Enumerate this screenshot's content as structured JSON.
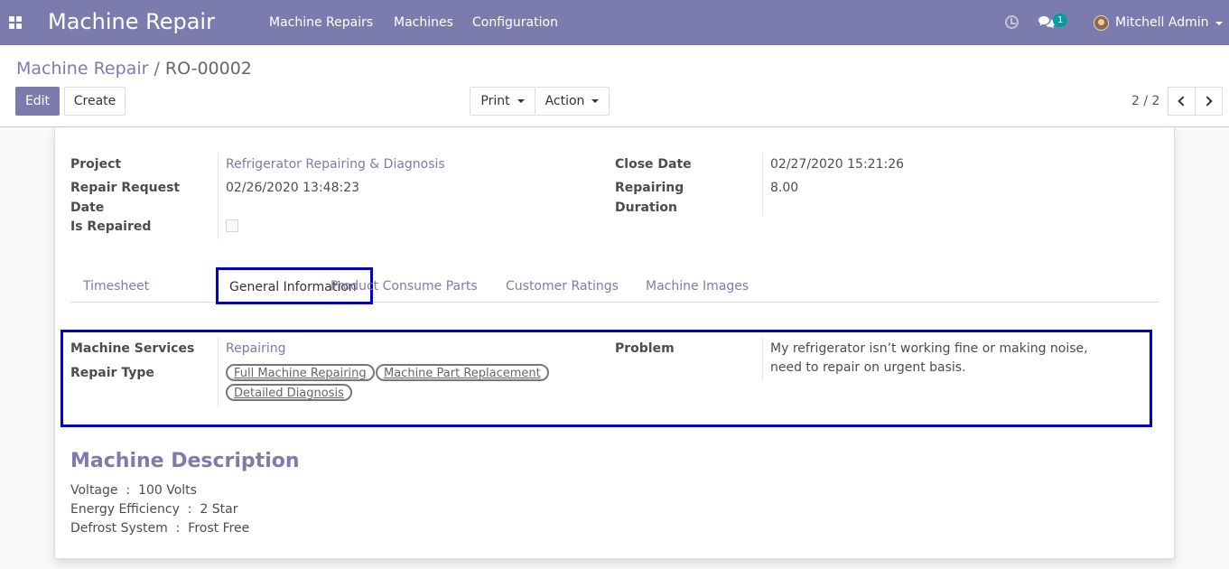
{
  "navbar": {
    "app_title": "Machine Repair",
    "menu": [
      "Machine Repairs",
      "Machines",
      "Configuration"
    ],
    "chat_count": "1",
    "user_name": "Mitchell Admin",
    "color": "#7c7bad"
  },
  "control_panel": {
    "breadcrumb_parent": "Machine Repair",
    "breadcrumb_separator": "/",
    "breadcrumb_current": "RO-00002",
    "edit_label": "Edit",
    "create_label": "Create",
    "print_label": "Print",
    "action_label": "Action",
    "pager_value": "2 / 2"
  },
  "form": {
    "project_label": "Project",
    "project_value": "Refrigerator Repairing & Diagnosis",
    "repair_request_date_label_1": "Repair Request",
    "repair_request_date_label_2": "Date",
    "repair_request_date_value": "02/26/2020 13:48:23",
    "is_repaired_label": "Is Repaired",
    "is_repaired_value": false,
    "close_date_label": "Close Date",
    "close_date_value": "02/27/2020 15:21:26",
    "repairing_duration_label_1": "Repairing",
    "repairing_duration_label_2": "Duration",
    "repairing_duration_value": "8.00"
  },
  "tabs": {
    "items": [
      "Timesheet",
      "General Information",
      "Product Consume Parts",
      "Customer Ratings",
      "Machine Images"
    ],
    "active": "General Information"
  },
  "general_info": {
    "machine_services_label": "Machine Services",
    "machine_services_value": "Repairing",
    "repair_type_label": "Repair Type",
    "repair_types": [
      "Full Machine Repairing",
      "Machine Part Replacement",
      "Detailed Diagnosis"
    ],
    "problem_label": "Problem",
    "problem_line_1": "My refrigerator isn’t working fine or making noise,",
    "problem_line_2": "need to repair on urgent basis."
  },
  "description": {
    "title": "Machine Description",
    "lines": [
      "Voltage  :  100 Volts",
      "Energy Efficiency  :  2 Star",
      "Defrost System  :  Frost Free"
    ]
  },
  "icons": {
    "apps": "apps-grid-icon",
    "activity": "clock-icon",
    "messages": "chat-icon",
    "pager_prev": "chevron-left-icon",
    "pager_next": "chevron-right-icon"
  }
}
